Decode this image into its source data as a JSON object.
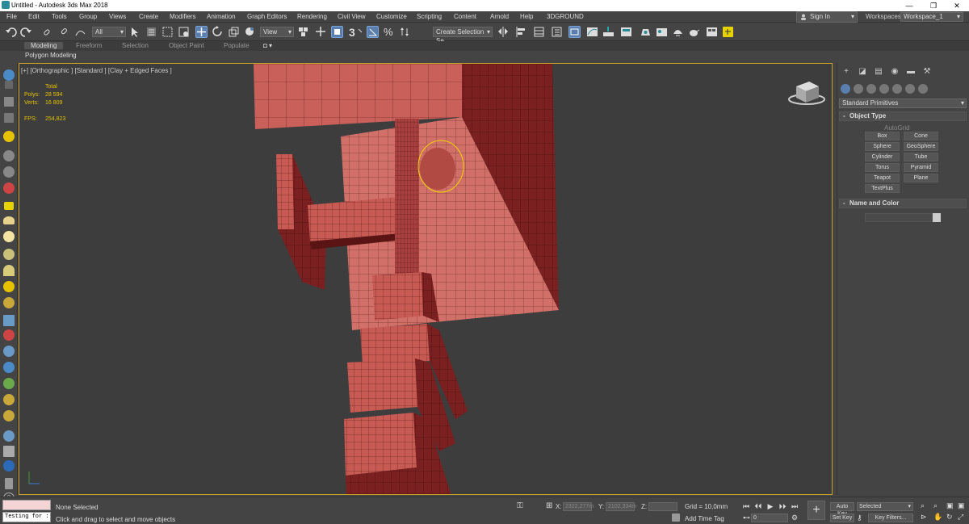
{
  "title": "Untitled - Autodesk 3ds Max 2018",
  "window_controls": {
    "minimize": "—",
    "maximize": "❐",
    "close": "✕"
  },
  "menu": [
    "File",
    "Edit",
    "Tools",
    "Group",
    "Views",
    "Create",
    "Modifiers",
    "Animation",
    "Graph Editors",
    "Rendering",
    "Civil View",
    "Customize",
    "Scripting",
    "Content",
    "Arnold",
    "Help",
    "3DGROUND"
  ],
  "signin": "Sign In",
  "workspaces_label": "Workspaces:",
  "workspace": "Workspace_1",
  "toolbar": {
    "filter": "All",
    "refcoord": "View",
    "selection_set": "Create Selection Se",
    "snaps_label": "3",
    "angle_snap": "%"
  },
  "ribbon_tabs": [
    "Modeling",
    "Freeform",
    "Selection",
    "Object Paint",
    "Populate"
  ],
  "ribbon_sub": "Polygon Modeling",
  "viewport": {
    "label": "[+] [Orthographic ] [Standard ] [Clay + Edged Faces ]",
    "stats": {
      "total_label": "Total",
      "polys_label": "Polys:",
      "polys": "28 594",
      "verts_label": "Verts:",
      "verts": "16 809",
      "fps_label": "FPS:",
      "fps": "254,823"
    }
  },
  "command_panel": {
    "category": "Standard Primitives",
    "object_type": "Object Type",
    "autogrid": "AutoGrid",
    "primitives": [
      "Box",
      "Cone",
      "Sphere",
      "GeoSphere",
      "Cylinder",
      "Tube",
      "Torus",
      "Pyramid",
      "Teapot",
      "Plane",
      "TextPlus"
    ],
    "name_and_color": "Name and Color"
  },
  "status": {
    "maxscript_text": "Testing for :",
    "selection": "None Selected",
    "prompt": "Click and drag to select and move objects",
    "x_label": "X:",
    "x": "2322,277m",
    "y_label": "Y:",
    "y": "2102,334m",
    "z_label": "Z:",
    "grid": "Grid = 10,0mm",
    "add_time_tag": "Add Time Tag",
    "auto_key": "Auto Key",
    "set_key": "Set Key",
    "selected": "Selected",
    "key_filters": "Key Filters...",
    "frame": "0"
  },
  "colors": {
    "accent": "#5a7fae",
    "viewport_border": "#c8a32a",
    "mesh": "#c85a50",
    "mesh_dark": "#7a2020"
  }
}
